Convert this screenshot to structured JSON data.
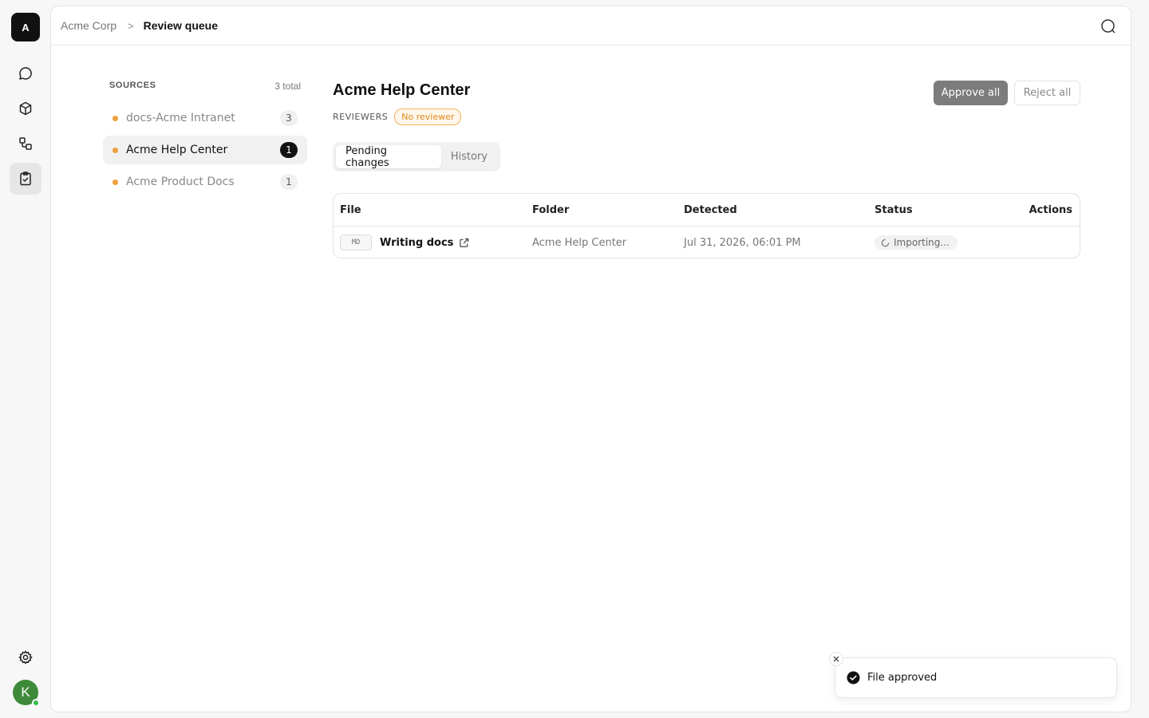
{
  "org": {
    "initial": "A"
  },
  "user": {
    "initial": "K"
  },
  "nav": {
    "items": [
      {
        "icon": "chat-bubble-icon"
      },
      {
        "icon": "cube-icon"
      },
      {
        "icon": "workflow-icon"
      },
      {
        "icon": "clipboard-check-icon",
        "active": true
      }
    ],
    "settings_icon": "gear-icon"
  },
  "breadcrumb": {
    "root": "Acme Corp",
    "separator": ">",
    "current": "Review queue"
  },
  "sources": {
    "title": "SOURCES",
    "total": "3 total",
    "items": [
      {
        "name": "docs-Acme Intranet",
        "count": "3",
        "active": false
      },
      {
        "name": "Acme Help Center",
        "count": "1",
        "active": true
      },
      {
        "name": "Acme Product Docs",
        "count": "1",
        "active": false
      }
    ]
  },
  "content": {
    "title": "Acme Help Center",
    "reviewers_label": "REVIEWERS",
    "reviewer_badge": "No reviewer",
    "approve_all": "Approve all",
    "reject_all": "Reject all"
  },
  "tabs": [
    {
      "label": "Pending changes",
      "active": true
    },
    {
      "label": "History",
      "active": false
    }
  ],
  "table": {
    "columns": [
      "File",
      "Folder",
      "Detected",
      "Status",
      "Actions"
    ],
    "rows": [
      {
        "type": "MD",
        "file": "Writing docs",
        "folder": "Acme Help Center",
        "detected": "Jul 31, 2026, 06:01 PM",
        "status": "Importing..."
      }
    ]
  },
  "toast": {
    "message": "File approved"
  },
  "colors": {
    "accent_dot": "#f0a03a",
    "warn_badge": "#e08a1e",
    "avatar": "#3f8a3a",
    "presence": "#2fbf4a"
  }
}
